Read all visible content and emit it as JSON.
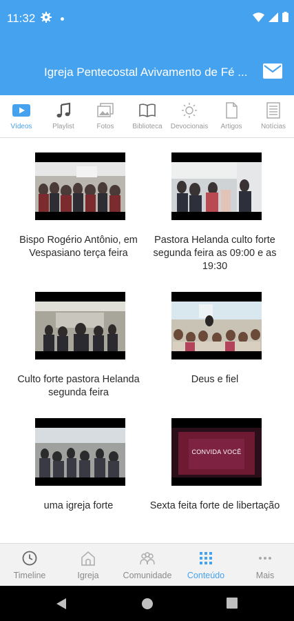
{
  "status_bar": {
    "time": "11:32",
    "icons": [
      "gear-icon",
      "wifi-icon",
      "signal-icon",
      "battery-icon"
    ]
  },
  "app_bar": {
    "title": "Igreja Pentecostal Avivamento de Fé ...",
    "action_icon": "mail-icon"
  },
  "colors": {
    "primary": "#45a2ee",
    "text": "#2a2a2a",
    "inactive": "#9a9a9a"
  },
  "tabs": [
    {
      "label": "Vídeos",
      "icon": "video-play-icon",
      "active": true
    },
    {
      "label": "Playlist",
      "icon": "music-note-icon",
      "active": false
    },
    {
      "label": "Fotos",
      "icon": "photos-icon",
      "active": false
    },
    {
      "label": "Biblioteca",
      "icon": "book-icon",
      "active": false
    },
    {
      "label": "Devocionais",
      "icon": "sun-icon",
      "active": false
    },
    {
      "label": "Artigos",
      "icon": "document-icon",
      "active": false
    },
    {
      "label": "Notícias",
      "icon": "newspaper-icon",
      "active": false
    }
  ],
  "videos": [
    {
      "title": "Bispo Rogério Antônio, em Vespasiano terça feira"
    },
    {
      "title": "Pastora Helanda culto forte segunda feira as 09:00 e as 19:30"
    },
    {
      "title": "Culto forte pastora Helanda segunda feira"
    },
    {
      "title": "Deus e fiel"
    },
    {
      "title": "uma igreja forte"
    },
    {
      "title": "Sexta feita forte de libertação",
      "thumb_text": "CONVIDA VOCÊ"
    }
  ],
  "bottom_nav": [
    {
      "label": "Timeline",
      "icon": "clock-icon",
      "active": false
    },
    {
      "label": "Igreja",
      "icon": "church-icon",
      "active": false
    },
    {
      "label": "Comunidade",
      "icon": "community-icon",
      "active": false
    },
    {
      "label": "Conteúdo",
      "icon": "grid-icon",
      "active": true
    },
    {
      "label": "Mais",
      "icon": "more-icon",
      "active": false
    }
  ]
}
